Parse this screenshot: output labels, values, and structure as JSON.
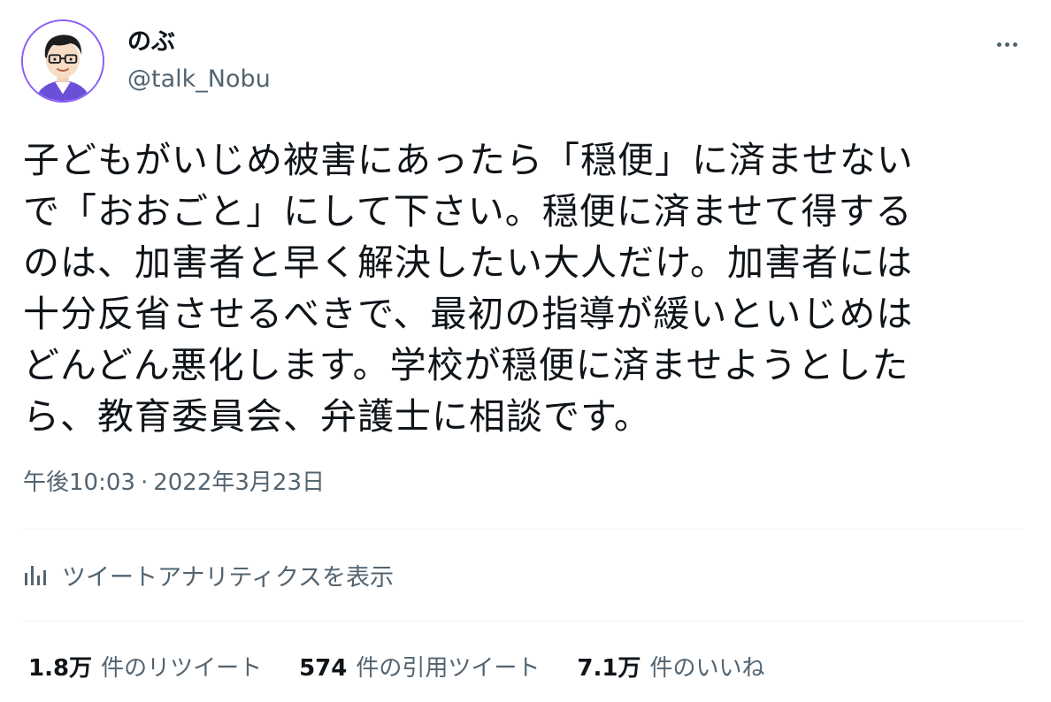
{
  "user": {
    "display_name": "のぶ",
    "handle": "@talk_Nobu",
    "avatar_icon": "avatar-illustration-man-with-glasses"
  },
  "more_icon": "more-horizontal-icon",
  "tweet": {
    "text": "子どもがいじめ被害にあったら「穏便」に済ませない\nで「おおごと」にして下さい。穏便に済ませて得する\nのは、加害者と早く解決したい大人だけ。加害者には\n十分反省させるべきで、最初の指導が緩いといじめは\nどんどん悪化します。学校が穏便に済ませようとした\nら、教育委員会、弁護士に相談です。",
    "time": "午後10:03",
    "separator": "·",
    "date": "2022年3月23日"
  },
  "analytics": {
    "icon": "analytics-bar-chart-icon",
    "label": "ツイートアナリティクスを表示"
  },
  "stats": [
    {
      "value": "1.8万",
      "label": "件のリツイート"
    },
    {
      "value": "574",
      "label": "件の引用ツイート"
    },
    {
      "value": "7.1万",
      "label": "件のいいね"
    }
  ],
  "colors": {
    "text_primary": "#0f1419",
    "text_secondary": "#536471",
    "divider": "#eff3f4",
    "avatar_ring": "#8a5cf5"
  }
}
